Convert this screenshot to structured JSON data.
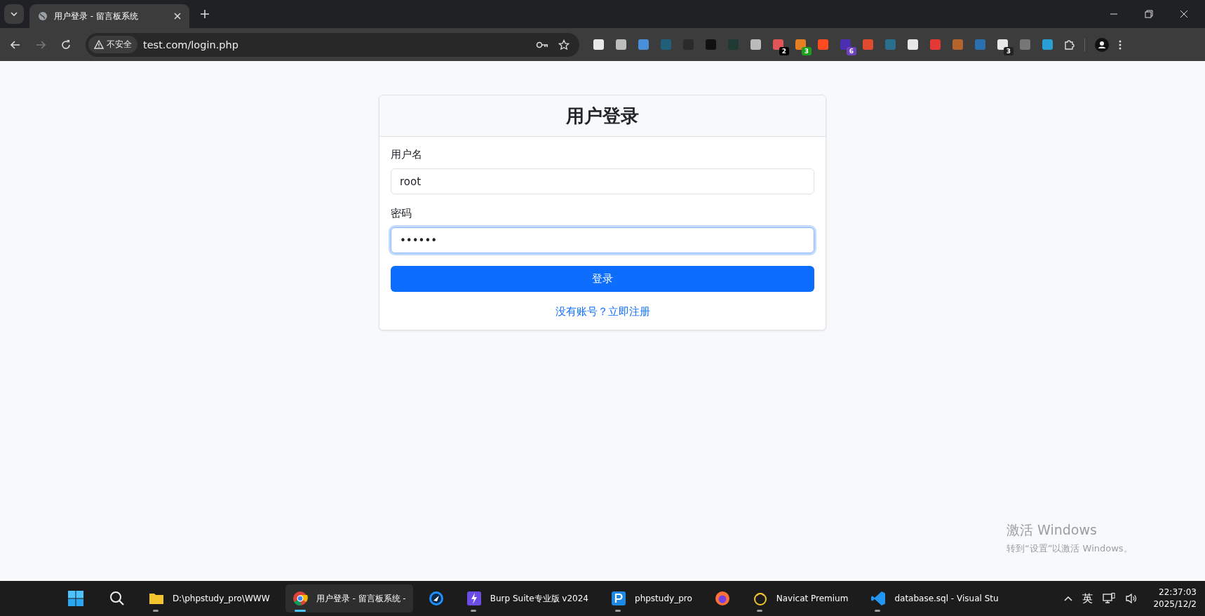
{
  "browser": {
    "tab": {
      "title": "用户登录 - 留言板系统",
      "selected": true
    },
    "address": {
      "security": "不安全",
      "url": "test.com/login.php"
    },
    "extensions": [
      {
        "color": "#e8e8e8"
      },
      {
        "color": "#bdbdbd"
      },
      {
        "color": "#4a90d9"
      },
      {
        "color": "#1f5f7a"
      },
      {
        "color": "#2a2a2a"
      },
      {
        "color": "#111111"
      },
      {
        "color": "#1e3a33"
      },
      {
        "color": "#bbbbbb"
      },
      {
        "color": "#e05555",
        "badge": {
          "text": "2",
          "color": "#000000"
        }
      },
      {
        "color": "#e67e22",
        "badge": {
          "text": "3",
          "color": "#1aa01a"
        }
      },
      {
        "color": "#ff4b1f"
      },
      {
        "color": "#4b2fb0",
        "badge": {
          "text": "6",
          "color": "#6f42c1"
        }
      },
      {
        "color": "#e04a2f"
      },
      {
        "color": "#2b6f8f"
      },
      {
        "color": "#e8e8e8"
      },
      {
        "color": "#e53935"
      },
      {
        "color": "#b5652b"
      },
      {
        "color": "#2a6fb0"
      },
      {
        "color": "#e8e8e8",
        "badge": {
          "text": "3",
          "color": "#222222"
        }
      },
      {
        "color": "#777777"
      },
      {
        "color": "#2a9fd6"
      }
    ]
  },
  "login": {
    "title": "用户登录",
    "fields": [
      {
        "label": "用户名",
        "value": "root",
        "focused": false
      },
      {
        "label": "密码",
        "value": "••••••",
        "focused": true
      }
    ],
    "submit": "登录",
    "register_link": "没有账号？立即注册"
  },
  "activation_notice": {
    "title": "激活 Windows",
    "text": "转到“设置”以激活 Windows。"
  },
  "taskbar": {
    "apps": [
      {
        "kind": "folder",
        "label": "D:\\phpstudy_pro\\WWW",
        "running": true,
        "selected": false
      },
      {
        "kind": "chrome",
        "label": "用户登录 - 留言板系统 -",
        "running": true,
        "selected": true
      },
      {
        "kind": "bird",
        "running": false,
        "selected": false
      },
      {
        "kind": "burp",
        "label": "Burp Suite专业版  v2024",
        "running": true,
        "selected": false
      },
      {
        "kind": "php",
        "label": "phpstudy_pro",
        "running": true,
        "selected": false
      },
      {
        "kind": "firefox",
        "running": false,
        "selected": false
      },
      {
        "kind": "navicat",
        "label": "Navicat Premium",
        "running": true,
        "selected": false
      },
      {
        "kind": "vscode",
        "label": "database.sql - Visual Stu",
        "running": true,
        "selected": false
      }
    ],
    "input_method": "英",
    "time": "22:37:03",
    "date": "2025/12/2"
  }
}
